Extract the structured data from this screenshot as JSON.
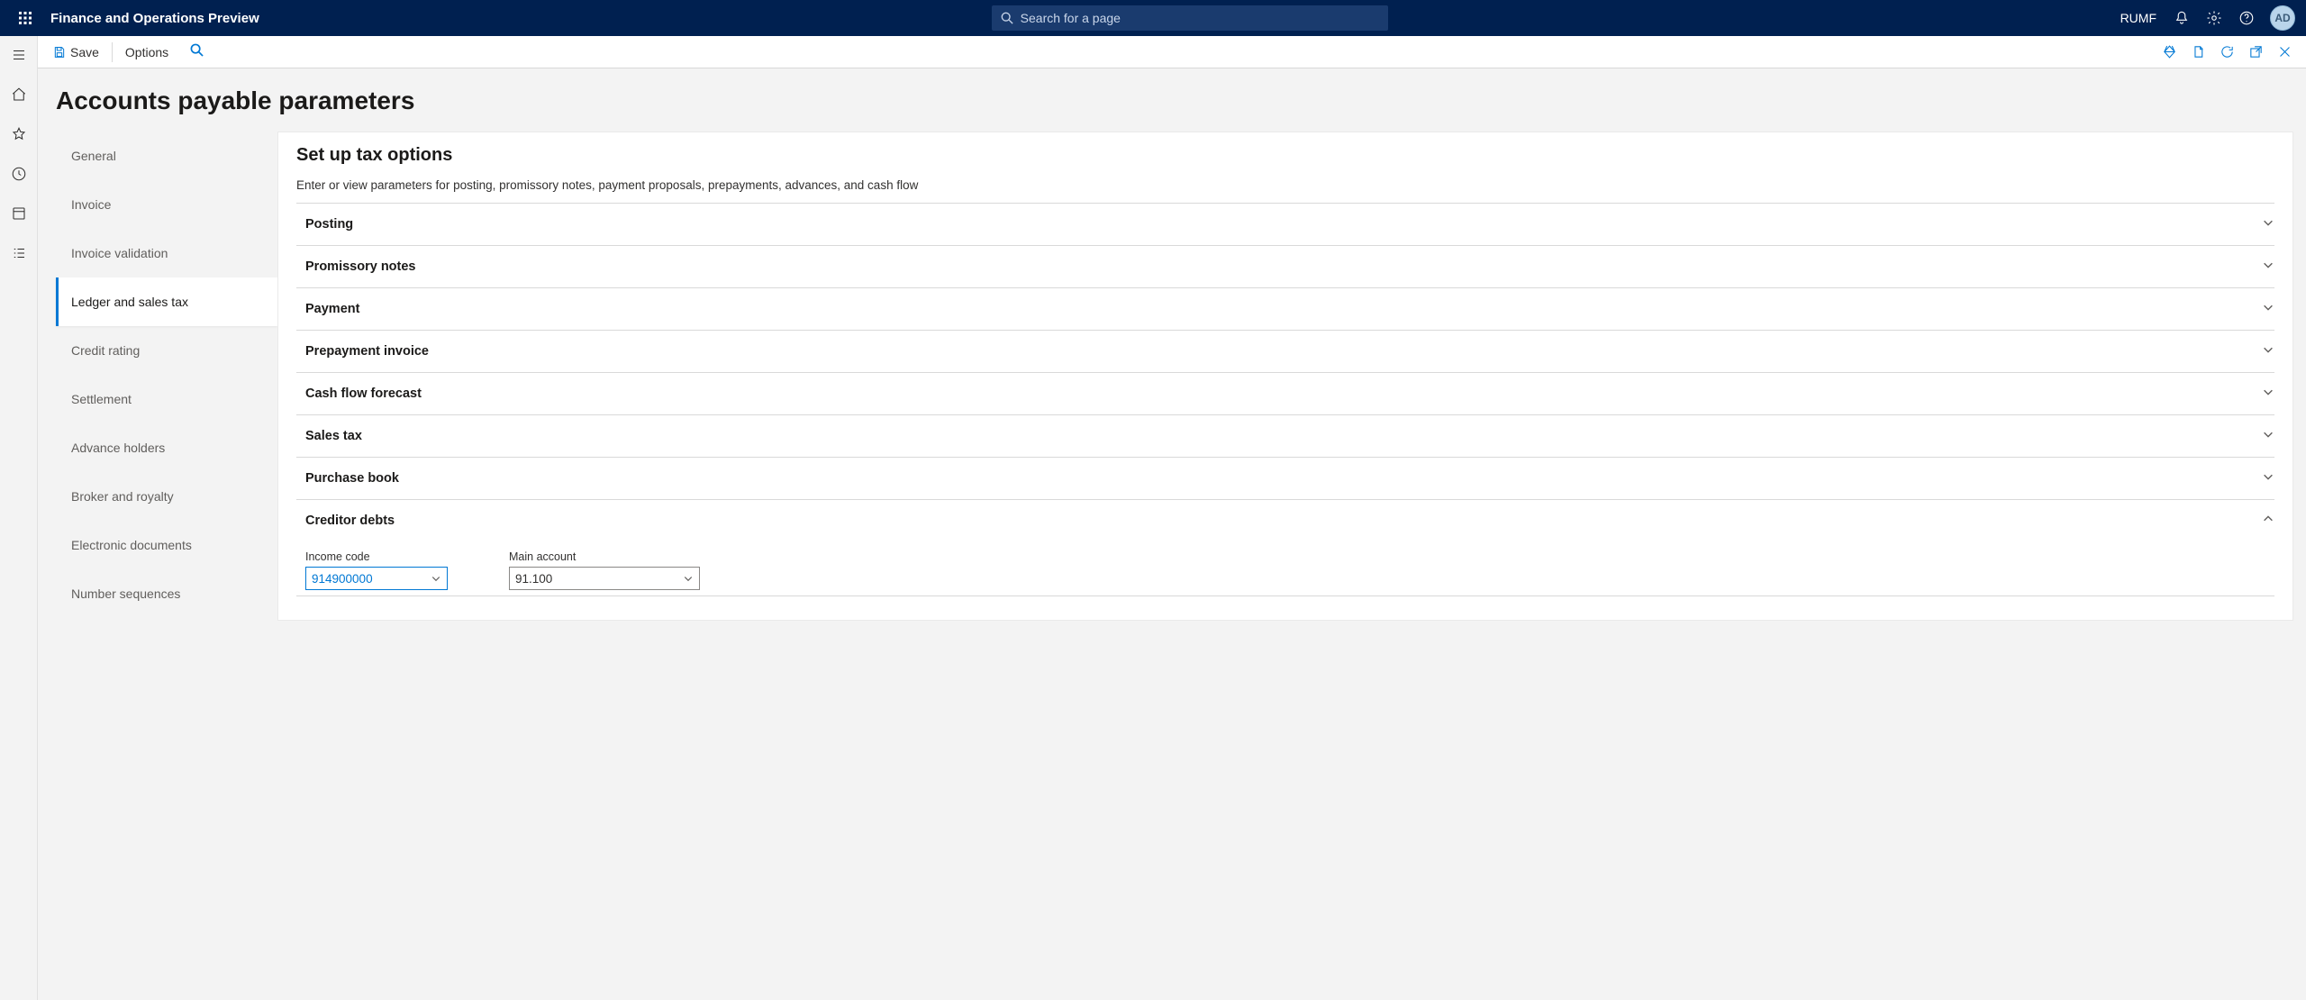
{
  "topbar": {
    "app_title": "Finance and Operations Preview",
    "search_placeholder": "Search for a page",
    "company": "RUMF",
    "avatar_initials": "AD"
  },
  "actionbar": {
    "save_label": "Save",
    "options_label": "Options"
  },
  "page": {
    "title": "Accounts payable parameters"
  },
  "param_nav": {
    "items": [
      {
        "label": "General"
      },
      {
        "label": "Invoice"
      },
      {
        "label": "Invoice validation"
      },
      {
        "label": "Ledger and sales tax",
        "active": true
      },
      {
        "label": "Credit rating"
      },
      {
        "label": "Settlement"
      },
      {
        "label": "Advance holders"
      },
      {
        "label": "Broker and royalty"
      },
      {
        "label": "Electronic documents"
      },
      {
        "label": "Number sequences"
      }
    ]
  },
  "panel": {
    "title": "Set up tax options",
    "description": "Enter or view parameters for posting, promissory notes, payment proposals, prepayments, advances, and cash flow"
  },
  "accordion": {
    "sections": [
      {
        "label": "Posting",
        "expanded": false
      },
      {
        "label": "Promissory notes",
        "expanded": false
      },
      {
        "label": "Payment",
        "expanded": false
      },
      {
        "label": "Prepayment invoice",
        "expanded": false
      },
      {
        "label": "Cash flow forecast",
        "expanded": false
      },
      {
        "label": "Sales tax",
        "expanded": false
      },
      {
        "label": "Purchase book",
        "expanded": false
      },
      {
        "label": "Creditor debts",
        "expanded": true
      }
    ]
  },
  "creditor_debts": {
    "income_code_label": "Income code",
    "income_code_value": "914900000",
    "main_account_label": "Main account",
    "main_account_value": "91.100"
  }
}
